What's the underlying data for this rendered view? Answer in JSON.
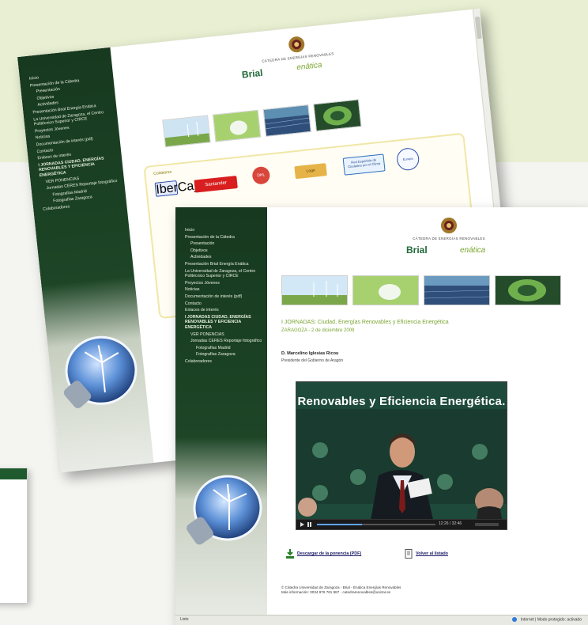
{
  "page": {
    "colors": {
      "background_top": "#e8efd2",
      "background_mid": "#f4f4f1",
      "sidebar_green": "#1d4526",
      "accent_green": "#7aa531"
    }
  },
  "back_window": {
    "nav": [
      "Inicio",
      "Presentación de la Cátedra",
      "Presentación",
      "Objetivos",
      "Actividades",
      "Presentación Brial Energía Enática",
      "La Universidad de Zaragoza, el Centro Politécnico Superior y CIRCE",
      "Proyectos Jóvenes",
      "Noticias",
      "Documentación de interés (pdf)",
      "Contacto",
      "Enlaces de interés",
      "I JORNADAS CIUDAD, ENERGÍAS RENOVABLES Y EFICIENCIA ENERGÉTICA",
      "VER PONENCIAS",
      "Jornadas CERES Reportaje fotográfico",
      "Fotografías Madrid",
      "Fotografías Zaragoza",
      "Colaboradores"
    ],
    "header": {
      "title": "CÁTEDRA DE ENERGÍAS RENOVABLES",
      "brand_left": "Brial",
      "brand_right": "enática"
    },
    "sponsors_title": "Colaboran",
    "sponsors": [
      "IberCaja",
      "Santander",
      "DHL",
      "Logo",
      "Red Española de Ciudades por el Clima",
      "Europa"
    ]
  },
  "front_window": {
    "nav": [
      "Inicio",
      "Presentación de la Cátedra",
      "Presentación",
      "Objetivos",
      "Actividades",
      "Presentación Brial Energía Enática",
      "La Universidad de Zaragoza, el Centro Politécnico Superior y CIRCE",
      "Proyectos Jóvenes",
      "Noticias",
      "Documentación de interés (pdf)",
      "Contacto",
      "Enlaces de interés",
      "I JORNADAS CIUDAD, ENERGÍAS RENOVABLES Y EFICIENCIA ENERGÉTICA",
      "VER PONENCIAS",
      "Jornadas CERES Reportaje fotográfico",
      "Fotografías Madrid",
      "Fotografías Zaragoza",
      "Colaboradores"
    ],
    "header": {
      "title": "CÁTEDRA DE ENERGÍAS RENOVABLES",
      "brand_left": "Brial",
      "brand_right": "enática"
    },
    "event": {
      "title": "I JORNADAS: Ciudad, Energías Renovables y Eficiencia Energética",
      "subtitle": "ZARAGOZA - 2 de diciembre 2009"
    },
    "speaker": {
      "name": "D. Marcelino Iglesias Ricou",
      "role": "Presidente del Gobierno de Aragón"
    },
    "video": {
      "banner": "Renovables y Eficiencia Energética.",
      "time": "12:26 / 32:46",
      "progress": 0.38
    },
    "links": {
      "download": "Descargar de la ponencia (PDF)",
      "back": "Volver al listado"
    },
    "footer": {
      "line1": "© Cátedra Universidad de Zaragoza - Brial - Enática Energías Renovables",
      "line2": "Más información: 0034 976 761 887 · catedrarenovables@unizar.es"
    },
    "statusbar": {
      "left": "Listo",
      "right": "Internet | Modo protegido: activado"
    }
  }
}
